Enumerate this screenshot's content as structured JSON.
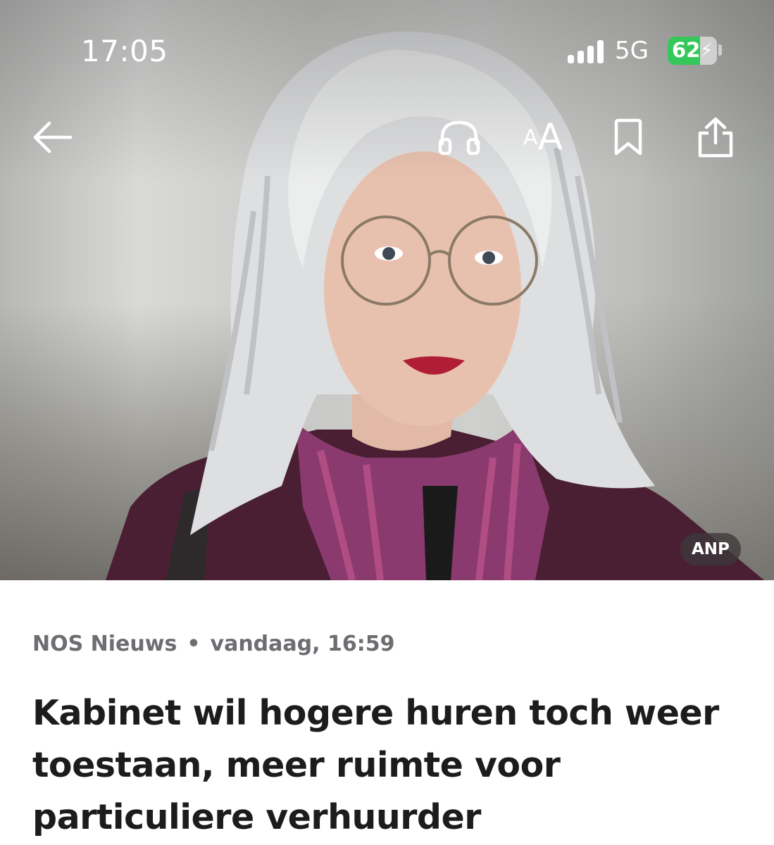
{
  "status_bar": {
    "time": "17:05",
    "network": "5G",
    "battery_percent": "62",
    "signal_bars": 4
  },
  "toolbar": {
    "back_icon": "arrow-left-icon",
    "listen_icon": "headphones-icon",
    "text_size_small": "A",
    "text_size_large": "A",
    "bookmark_icon": "bookmark-icon",
    "share_icon": "share-icon"
  },
  "hero": {
    "credit": "ANP"
  },
  "article": {
    "source": "NOS Nieuws",
    "separator": "•",
    "timestamp": "vandaag, 16:59",
    "headline": "Kabinet wil hogere huren toch weer toestaan, meer ruimte voor particuliere verhuurder"
  },
  "colors": {
    "battery_green": "#35c759",
    "meta_gray": "#6d6d72",
    "headline": "#1c1c1e"
  }
}
